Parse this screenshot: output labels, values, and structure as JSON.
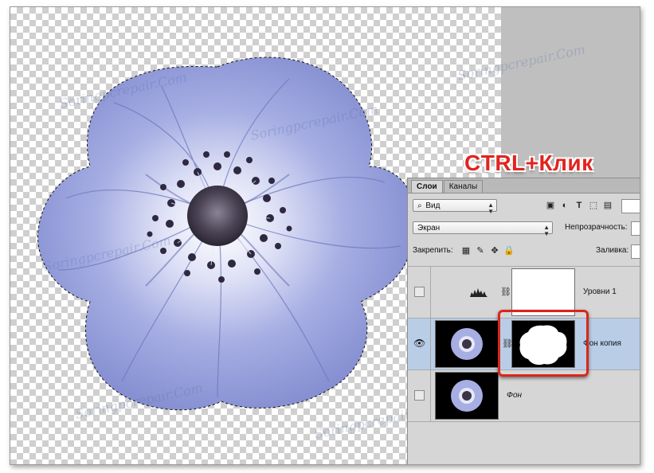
{
  "annotation": {
    "shortcut_label": "CTRL+Клик"
  },
  "watermark": {
    "text": "Soringpcrepair.Com"
  },
  "layers_panel": {
    "tabs": [
      {
        "label": "Слои"
      },
      {
        "label": "Каналы"
      }
    ],
    "filter": {
      "icon": "search-icon",
      "value": "Вид"
    },
    "blend_mode": {
      "value": "Экран"
    },
    "opacity": {
      "label": "Непрозрачность:"
    },
    "lock": {
      "label": "Закрепить:"
    },
    "fill": {
      "label": "Заливка:"
    },
    "layers": [
      {
        "name": "Уровни 1",
        "type": "adjustment-levels",
        "visible": false,
        "selected": false
      },
      {
        "name": "Фон копия",
        "type": "image-with-mask",
        "visible": true,
        "selected": true
      },
      {
        "name": "Фон",
        "type": "image",
        "visible": false,
        "selected": false
      }
    ]
  },
  "colors": {
    "highlight": "#d9261c",
    "selected_layer": "#b9cde6",
    "petal": "#8b96d8"
  }
}
